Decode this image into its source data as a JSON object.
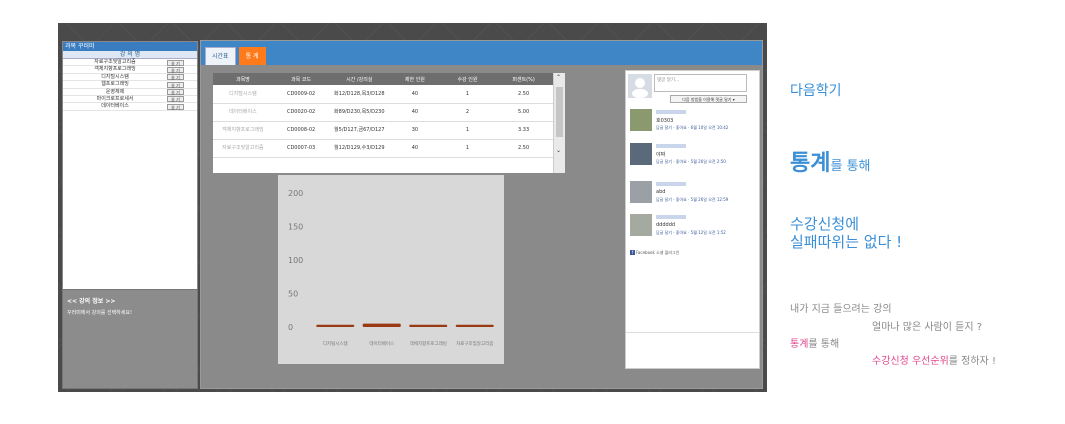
{
  "left_panel": {
    "title": "과목 꾸러미",
    "column_header": "강 의 명",
    "courses": [
      {
        "name": "자료구조및알고리즘",
        "button": "송 기"
      },
      {
        "name": "객체지향프로그래밍",
        "button": "송 기"
      },
      {
        "name": "디지털시스템",
        "button": "송 기"
      },
      {
        "name": "웹프로그래밍",
        "button": "송 기"
      },
      {
        "name": "운영체제",
        "button": "송 기"
      },
      {
        "name": "마이크로프로세서",
        "button": "송 기"
      },
      {
        "name": "데이터베이스",
        "button": "송 기"
      }
    ]
  },
  "lecture_info": {
    "title": "<< 강의 정보 >>",
    "message": "꾸러미에서 강의를 선택하세요!"
  },
  "tabs": [
    {
      "label": "시간표",
      "active": false
    },
    {
      "label": "통 계",
      "active": true
    }
  ],
  "stats_table": {
    "headers": [
      "과목명",
      "과목 코드",
      "시간 /강의실",
      "제한 인원",
      "수강 인원",
      "퍼센트(%)"
    ],
    "rows": [
      [
        "디지털시스템",
        "CD0009-02",
        "화12/D128,목3/D128",
        "40",
        "1",
        "2.50"
      ],
      [
        "데이터베이스",
        "CD0020-02",
        "화89/D230,목5/D230",
        "40",
        "2",
        "5.00"
      ],
      [
        "객체지향프로그래밍",
        "CD0008-02",
        "월5/D127,금67/D127",
        "30",
        "1",
        "3.33"
      ],
      [
        "자료구조및알고리즘",
        "CD0007-03",
        "월12/D129,수3/D129",
        "40",
        "1",
        "2.50"
      ]
    ]
  },
  "chart_data": {
    "type": "bar",
    "categories": [
      "디지털시스템",
      "데이터베이스",
      "객체지향프로그래밍",
      "자료구조및알고리즘"
    ],
    "values": [
      2.5,
      5.0,
      3.33,
      2.5
    ],
    "y_ticks": [
      0,
      50,
      100,
      150,
      200
    ],
    "ylim": [
      0,
      200
    ],
    "bar_color": "#9a3a14"
  },
  "facebook": {
    "placeholder": "댓글 달기...",
    "post_button": "다음 방법을 이용해 댓글 달기 ▾",
    "comments": [
      {
        "text": "호0303",
        "actions": "답글 달기 · 좋아요 · 6월 10일 오전 10:42"
      },
      {
        "text": "야짜",
        "actions": "답글 달기 · 좋아요 · 5월 26일 오전 2:50"
      },
      {
        "text": "abd",
        "actions": "답글 달기 · 좋아요 · 5월 26일 오전 12:59"
      },
      {
        "text": "dddddd",
        "actions": "답글 달기 · 좋아요 · 5월 12일 오전 1:52"
      }
    ],
    "plugin_label": "Facebook 소셜 플러그인"
  },
  "promo": {
    "line1": "다음학기",
    "big": "통계",
    "big_suffix": "를 통해",
    "line3a": "수강신청에",
    "line3b": "실패따위는 없다 !",
    "line4": "내가 지금 들으려는 강의",
    "line5": "얼마나 많은 사람이 듣지 ?",
    "line6_hl": "통계",
    "line6_rest": "를 통해",
    "line7_hl": "수강신청 우선순위",
    "line7_rest": "를 정하자 !"
  },
  "colors": {
    "accent_blue": "#3b8fd6",
    "tab_active": "#ff7a1a",
    "highlight_pink": "#e0458c"
  }
}
